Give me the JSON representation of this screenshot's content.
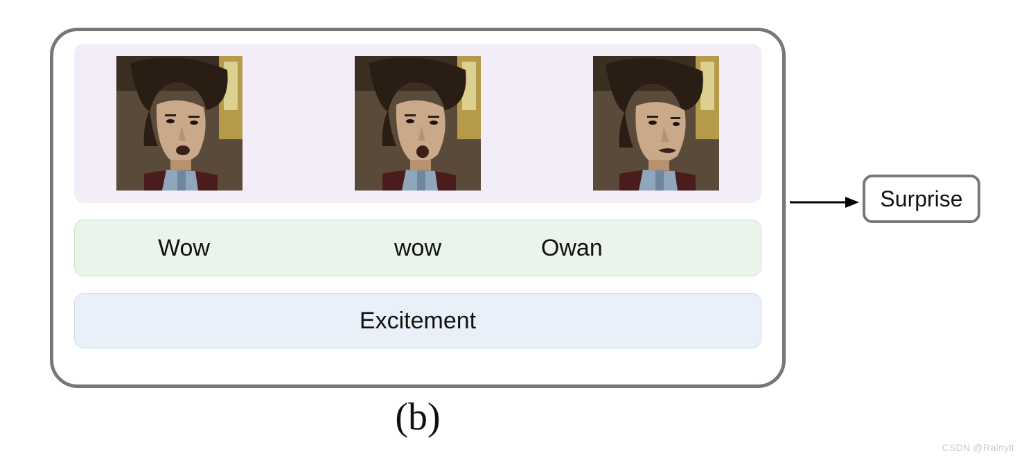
{
  "panels": {
    "words": [
      "Wow",
      "wow",
      "Owan"
    ],
    "emotion_label": "Excitement",
    "image_alt": "video-frame-face"
  },
  "output": {
    "label": "Surprise"
  },
  "figure": {
    "label": "(b)"
  },
  "watermark": "CSDN @Rainylt",
  "colors": {
    "panel_images_bg": "#f3edf7",
    "panel_words_bg": "#eaf4ea",
    "panel_emotion_bg": "#eaf0f9",
    "border_gray": "#777"
  }
}
